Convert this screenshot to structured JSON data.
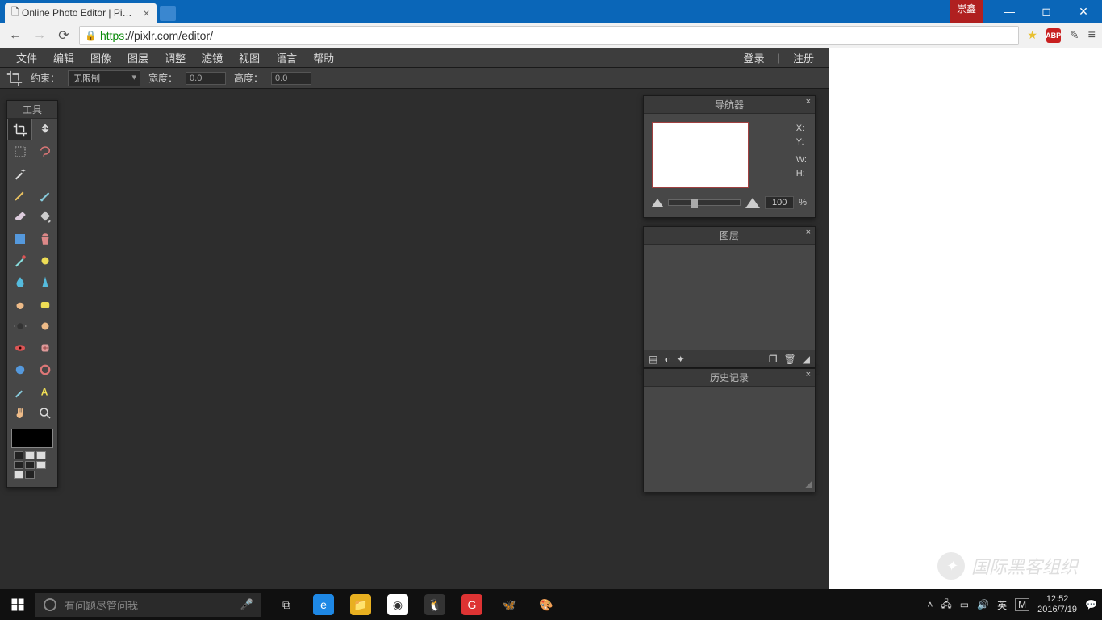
{
  "window": {
    "tab_title": "Online Photo Editor | Pi…",
    "user_badge": "崇鑫"
  },
  "browser": {
    "url_protocol": "https",
    "url_rest": "://pixlr.com/editor/"
  },
  "menubar": {
    "items": [
      "文件",
      "编辑",
      "图像",
      "图层",
      "调整",
      "滤镜",
      "视图",
      "语言",
      "帮助"
    ],
    "login": "登录",
    "register": "注册"
  },
  "optbar": {
    "constrain_label": "约束：",
    "constrain_value": "无限制",
    "width_label": "宽度：",
    "width_value": "0.0",
    "height_label": "高度：",
    "height_value": "0.0"
  },
  "tools_panel": {
    "title": "工具"
  },
  "nav_panel": {
    "title": "导航器",
    "x_label": "X:",
    "y_label": "Y:",
    "w_label": "W:",
    "h_label": "H:",
    "zoom_value": "100",
    "zoom_pct": "%"
  },
  "layers_panel": {
    "title": "图层"
  },
  "history_panel": {
    "title": "历史记录"
  },
  "watermark": {
    "text": "国际黑客组织"
  },
  "taskbar": {
    "search_placeholder": "有问题尽管问我",
    "ime": "英",
    "ime2": "M",
    "clock_time": "12:52",
    "clock_date": "2016/7/19"
  }
}
